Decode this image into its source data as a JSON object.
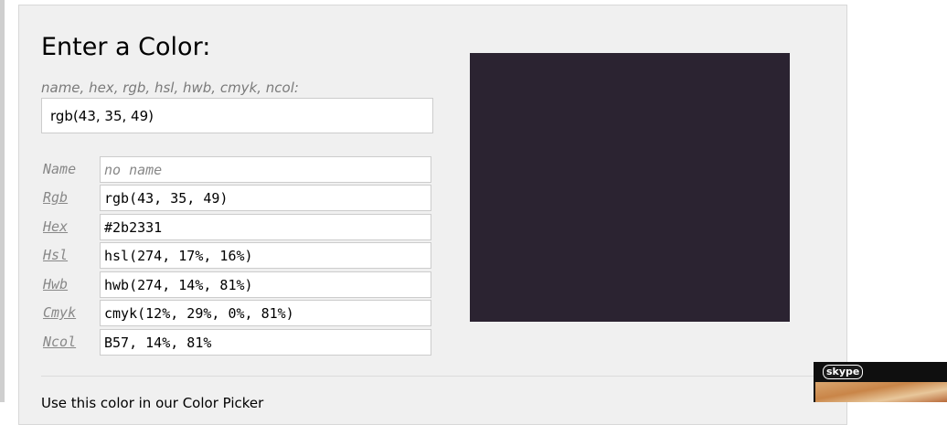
{
  "heading": "Enter a Color:",
  "hint": "name, hex, rgb, hsl, hwb, cmyk, ncol:",
  "main_input": {
    "value": "rgb(43, 35, 49)"
  },
  "fields": [
    {
      "label": "Name",
      "value": "",
      "placeholder": "no name",
      "link": false
    },
    {
      "label": "Rgb",
      "value": "rgb(43, 35, 49)",
      "placeholder": "",
      "link": true
    },
    {
      "label": "Hex",
      "value": "#2b2331",
      "placeholder": "",
      "link": true
    },
    {
      "label": "Hsl",
      "value": "hsl(274, 17%, 16%)",
      "placeholder": "",
      "link": true
    },
    {
      "label": "Hwb",
      "value": "hwb(274, 14%, 81%)",
      "placeholder": "",
      "link": true
    },
    {
      "label": "Cmyk",
      "value": "cmyk(12%, 29%, 0%, 81%)",
      "placeholder": "",
      "link": true
    },
    {
      "label": "Ncol",
      "value": "B57, 14%, 81%",
      "placeholder": "",
      "link": true
    }
  ],
  "swatch": {
    "color": "#2b2331"
  },
  "bottom_text": "Use this color in our Color Picker",
  "skype_widget": {
    "logo": "skype"
  },
  "colors": {
    "panel_bg": "#f0f0f0",
    "label_color": "#888888"
  }
}
